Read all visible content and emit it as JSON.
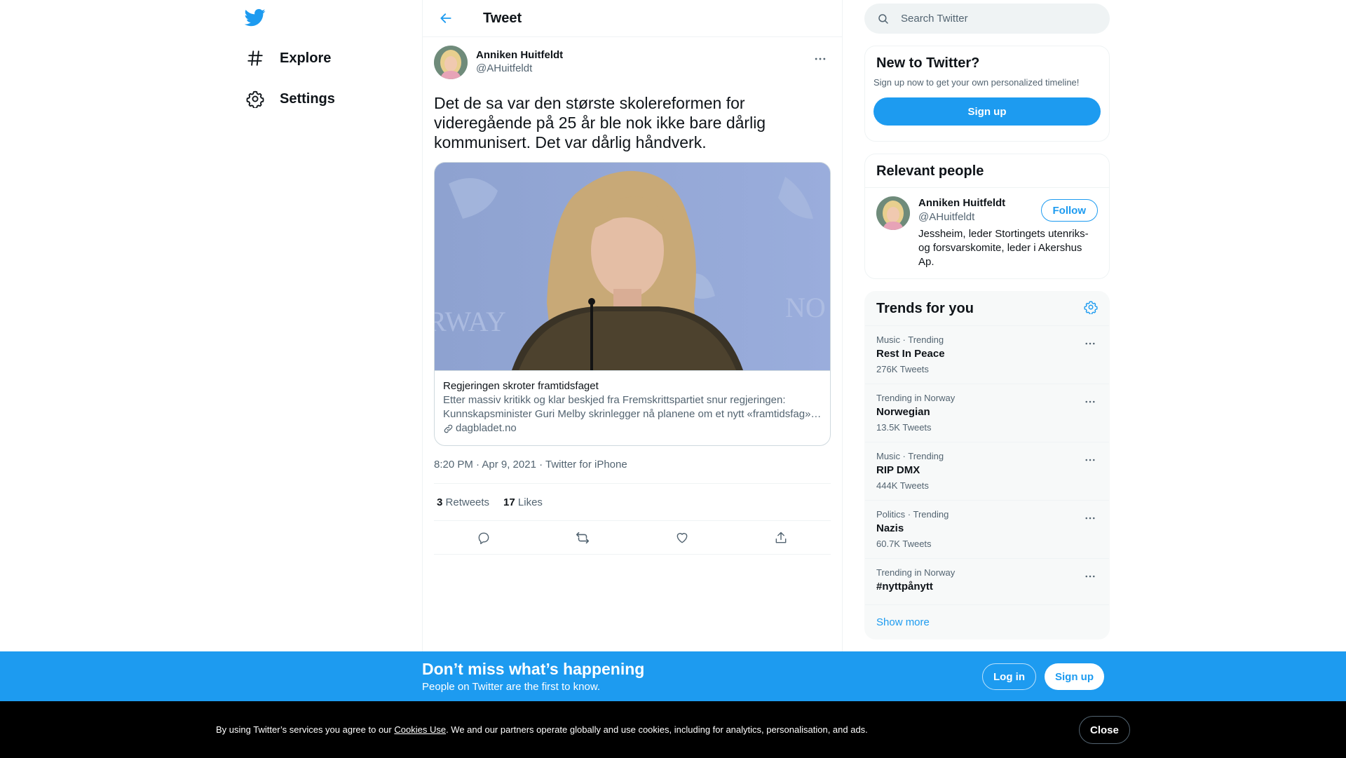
{
  "nav": {
    "logo_icon": "twitter-bird-icon",
    "items": [
      {
        "label": "Explore",
        "icon": "hashtag-icon"
      },
      {
        "label": "Settings",
        "icon": "gear-icon"
      }
    ]
  },
  "header": {
    "title": "Tweet",
    "back_icon": "arrow-left-icon"
  },
  "tweet": {
    "author_name": "Anniken Huitfeldt",
    "author_handle": "@AHuitfeldt",
    "text": "Det de sa var den største skolereformen for videregående på 25 år ble nok ikke bare dårlig kommunisert. Det var dårlig håndverk.",
    "card": {
      "title": "Regjeringen skroter framtidsfaget",
      "description": "Etter massiv kritikk og klar beskjed fra Fremskrittspartiet snur regjeringen: Kunnskapsminister Guri Melby skrinlegger nå planene om et nytt «framtidsfag» i videregående skole.",
      "domain": "dagbladet.no"
    },
    "meta": "8:20 PM · Apr 9, 2021 · Twitter for iPhone",
    "retweets_count": "3",
    "retweets_label": "Retweets",
    "likes_count": "17",
    "likes_label": "Likes"
  },
  "search": {
    "placeholder": "Search Twitter"
  },
  "new_to_twitter": {
    "title": "New to Twitter?",
    "subtitle": "Sign up now to get your own personalized timeline!",
    "button": "Sign up"
  },
  "relevant_people": {
    "title": "Relevant people",
    "person": {
      "name": "Anniken Huitfeldt",
      "handle": "@AHuitfeldt",
      "bio": "Jessheim, leder Stortingets utenriks- og forsvarskomite, leder i Akershus Ap.",
      "follow_label": "Follow"
    }
  },
  "trends": {
    "title": "Trends for you",
    "items": [
      {
        "context": "Music · Trending",
        "name": "Rest In Peace",
        "count": "276K Tweets"
      },
      {
        "context": "Trending in Norway",
        "name": "Norwegian",
        "count": "13.5K Tweets"
      },
      {
        "context": "Music · Trending",
        "name": "RIP DMX",
        "count": "444K Tweets"
      },
      {
        "context": "Politics · Trending",
        "name": "Nazis",
        "count": "60.7K Tweets"
      },
      {
        "context": "Trending in Norway",
        "name": "#nyttpånytt",
        "count": ""
      }
    ],
    "show_more": "Show more"
  },
  "bottom_bar": {
    "title": "Don’t miss what’s happening",
    "subtitle": "People on Twitter are the first to know.",
    "login": "Log in",
    "signup": "Sign up"
  },
  "cookie": {
    "before": "By using Twitter’s services you agree to our ",
    "link": "Cookies Use",
    "after": ". We and our partners operate globally and use cookies, including for analytics, personalisation, and ads.",
    "close": "Close"
  },
  "colors": {
    "accent": "#1d9bf0",
    "text": "#0f1419",
    "secondary": "#536471"
  }
}
